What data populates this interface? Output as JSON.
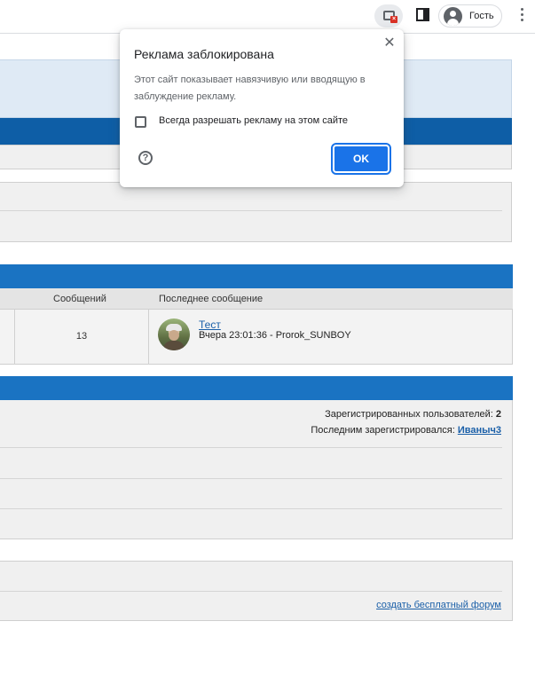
{
  "toolbar": {
    "profile_label": "Гость"
  },
  "popup": {
    "title": "Реклама заблокирована",
    "close_glyph": "✕",
    "description": "Этот сайт показывает навязчивую или вводящую в заблуждение рекламу.",
    "checkbox_label": "Всегда разрешать рекламу на этом сайте",
    "checkbox_checked": false,
    "help_glyph": "?",
    "ok_label": "OK"
  },
  "forums_table": {
    "col_messages": "Сообщений",
    "col_last_post": "Последнее сообщение",
    "rows": [
      {
        "message_count": "13",
        "last_post_title": "Тест",
        "last_post_meta": "Вчера 23:01:36 - Prorok_SUNBOY"
      }
    ]
  },
  "stats": {
    "registered_label": "Зарегистрированных пользователей:",
    "registered_count": "2",
    "newest_label": "Последним зарегистрировался:",
    "newest_user": "Иваныч3"
  },
  "footer": {
    "link_label": "создать бесплатный форум"
  },
  "colors": {
    "header_bar": "#0e5ea6",
    "section_bar": "#1a73c2",
    "ok_button": "#1a73e8",
    "blocked_indicator": "#d93025"
  }
}
